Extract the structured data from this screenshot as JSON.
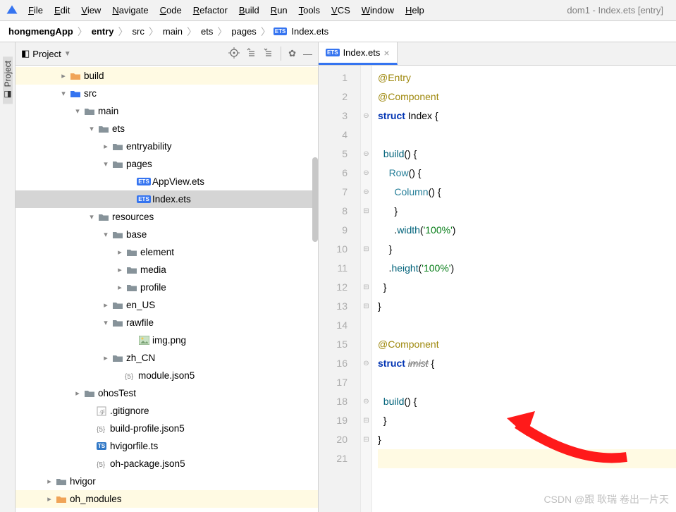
{
  "window_title": "dom1 - Index.ets [entry]",
  "menu": [
    "File",
    "Edit",
    "View",
    "Navigate",
    "Code",
    "Refactor",
    "Build",
    "Run",
    "Tools",
    "VCS",
    "Window",
    "Help"
  ],
  "breadcrumb": [
    {
      "label": "hongmengApp",
      "bold": true
    },
    {
      "label": "entry",
      "bold": true
    },
    {
      "label": "src",
      "bold": false
    },
    {
      "label": "main",
      "bold": false
    },
    {
      "label": "ets",
      "bold": false
    },
    {
      "label": "pages",
      "bold": false
    },
    {
      "label": "Index.ets",
      "bold": false,
      "icon": "ets"
    }
  ],
  "project_panel": {
    "title": "Project"
  },
  "sidebar_label": "Project",
  "tree": [
    {
      "indent": 60,
      "arrow": "right",
      "icon": "folder-orange",
      "label": "build",
      "hl": true
    },
    {
      "indent": 60,
      "arrow": "down",
      "icon": "folder-blue",
      "label": "src"
    },
    {
      "indent": 80,
      "arrow": "down",
      "icon": "folder-normal",
      "label": "main"
    },
    {
      "indent": 100,
      "arrow": "down",
      "icon": "folder-normal",
      "label": "ets"
    },
    {
      "indent": 120,
      "arrow": "right",
      "icon": "folder-normal",
      "label": "entryability"
    },
    {
      "indent": 120,
      "arrow": "down",
      "icon": "folder-normal",
      "label": "pages"
    },
    {
      "indent": 157,
      "arrow": "",
      "icon": "ets",
      "label": "AppView.ets"
    },
    {
      "indent": 157,
      "arrow": "",
      "icon": "ets",
      "label": "Index.ets",
      "sel": true
    },
    {
      "indent": 100,
      "arrow": "down",
      "icon": "folder-normal",
      "label": "resources"
    },
    {
      "indent": 120,
      "arrow": "down",
      "icon": "folder-normal",
      "label": "base"
    },
    {
      "indent": 140,
      "arrow": "right",
      "icon": "folder-normal",
      "label": "element"
    },
    {
      "indent": 140,
      "arrow": "right",
      "icon": "folder-normal",
      "label": "media"
    },
    {
      "indent": 140,
      "arrow": "right",
      "icon": "folder-normal",
      "label": "profile"
    },
    {
      "indent": 120,
      "arrow": "right",
      "icon": "folder-normal",
      "label": "en_US"
    },
    {
      "indent": 120,
      "arrow": "down",
      "icon": "folder-normal",
      "label": "rawfile"
    },
    {
      "indent": 157,
      "arrow": "",
      "icon": "img",
      "label": "img.png"
    },
    {
      "indent": 120,
      "arrow": "right",
      "icon": "folder-normal",
      "label": "zh_CN"
    },
    {
      "indent": 137,
      "arrow": "",
      "icon": "json5",
      "label": "module.json5"
    },
    {
      "indent": 80,
      "arrow": "right",
      "icon": "folder-gray",
      "label": "ohosTest"
    },
    {
      "indent": 97,
      "arrow": "",
      "icon": "gitignore",
      "label": ".gitignore"
    },
    {
      "indent": 97,
      "arrow": "",
      "icon": "json5",
      "label": "build-profile.json5"
    },
    {
      "indent": 97,
      "arrow": "",
      "icon": "ts",
      "label": "hvigorfile.ts"
    },
    {
      "indent": 97,
      "arrow": "",
      "icon": "json5",
      "label": "oh-package.json5"
    },
    {
      "indent": 40,
      "arrow": "right",
      "icon": "folder-gray",
      "label": "hvigor"
    },
    {
      "indent": 40,
      "arrow": "right",
      "icon": "folder-orange",
      "label": "oh_modules",
      "hl": true
    }
  ],
  "editor_tab": {
    "label": "Index.ets"
  },
  "code": {
    "lines": [
      {
        "n": 1,
        "html": "<span class='k-anno'>@Entry</span>"
      },
      {
        "n": 2,
        "html": "<span class='k-anno'>@Component</span>"
      },
      {
        "n": 3,
        "html": "<span class='k-kw'>struct</span> <span class='k-struct'>Index</span> <span class='k-brace'>{</span>"
      },
      {
        "n": 4,
        "html": ""
      },
      {
        "n": 5,
        "html": "  <span class='k-fn'>build</span>() <span class='k-brace'>{</span>"
      },
      {
        "n": 6,
        "html": "    <span class='k-type'>Row</span>() <span class='k-brace'>{</span>"
      },
      {
        "n": 7,
        "html": "      <span class='k-type'>Column</span>() <span class='k-brace'>{</span>"
      },
      {
        "n": 8,
        "html": "      <span class='k-brace'>}</span>"
      },
      {
        "n": 9,
        "html": "      .<span class='k-fn'>width</span>(<span class='k-str'>'100%'</span>)"
      },
      {
        "n": 10,
        "html": "    <span class='k-brace'>}</span>"
      },
      {
        "n": 11,
        "html": "    .<span class='k-fn'>height</span>(<span class='k-str'>'100%'</span>)"
      },
      {
        "n": 12,
        "html": "  <span class='k-brace'>}</span>"
      },
      {
        "n": 13,
        "html": "<span class='k-brace'>}</span>"
      },
      {
        "n": 14,
        "html": ""
      },
      {
        "n": 15,
        "html": "<span class='k-anno'>@Component</span>"
      },
      {
        "n": 16,
        "html": "<span class='k-kw'>struct</span> <span class='k-italic'>imist</span> <span class='k-brace'>{</span>"
      },
      {
        "n": 17,
        "html": ""
      },
      {
        "n": 18,
        "html": "  <span class='k-fn'>build</span>() <span class='k-brace'>{</span>"
      },
      {
        "n": 19,
        "html": "  <span class='k-brace'>}</span>"
      },
      {
        "n": 20,
        "html": "<span class='k-brace'>}</span>"
      },
      {
        "n": 21,
        "html": "",
        "caret": true
      }
    ],
    "fold": [
      "",
      "",
      "⊖",
      "",
      "⊖",
      "⊖",
      "⊖",
      "⊟",
      "",
      "⊟",
      "",
      "⊟",
      "⊟",
      "",
      "",
      "⊖",
      "",
      "⊖",
      "⊟",
      "⊟",
      ""
    ]
  },
  "watermark": "CSDN @跟 耿瑞 卷出一片天"
}
